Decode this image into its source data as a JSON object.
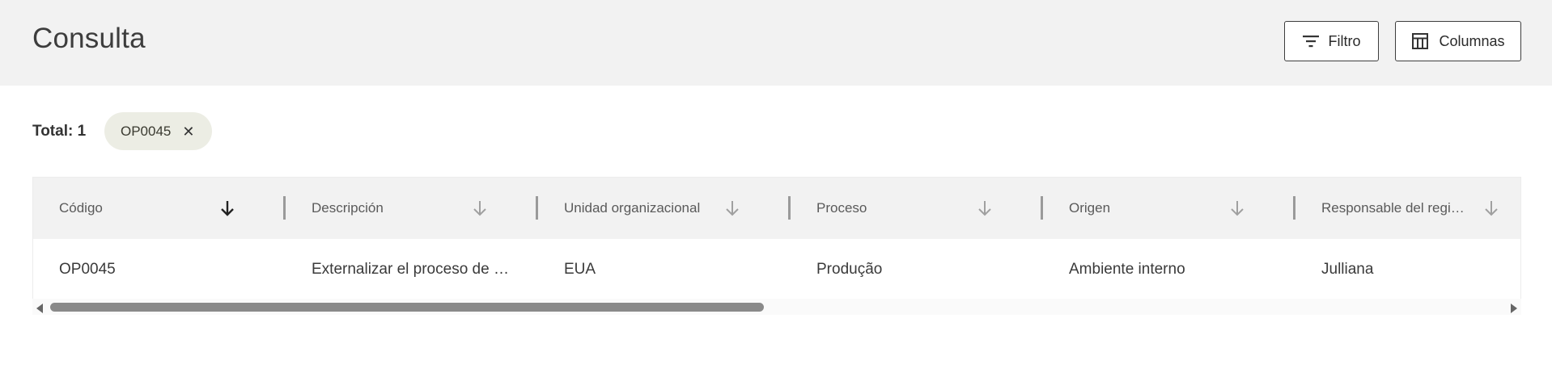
{
  "header": {
    "title": "Consulta",
    "filter_button": {
      "label": "Filtro",
      "icon": "filter-icon"
    },
    "columns_button": {
      "label": "Columnas",
      "icon": "columns-icon"
    }
  },
  "summary": {
    "total_label": "Total: 1"
  },
  "active_filters": [
    {
      "label": "OP0045",
      "icon": "close-icon"
    }
  ],
  "table": {
    "columns": [
      {
        "label": "Código",
        "sort": "active"
      },
      {
        "label": "Descripción",
        "sort": "inactive"
      },
      {
        "label": "Unidad organizacional",
        "sort": "inactive"
      },
      {
        "label": "Proceso",
        "sort": "inactive"
      },
      {
        "label": "Origen",
        "sort": "inactive"
      },
      {
        "label": "Responsable del regi…",
        "sort": "inactive"
      }
    ],
    "rows": [
      [
        "OP0045",
        "Externalizar el proceso de …",
        "EUA",
        "Produção",
        "Ambiente interno",
        "Julliana"
      ]
    ]
  },
  "scrollbar": {
    "visible_fraction": 0.48
  },
  "colors": {
    "header_bg": "#f2f2f2",
    "chip_bg": "#ecede4",
    "sort_active": "#222222",
    "sort_inactive": "#9a9a9a"
  }
}
